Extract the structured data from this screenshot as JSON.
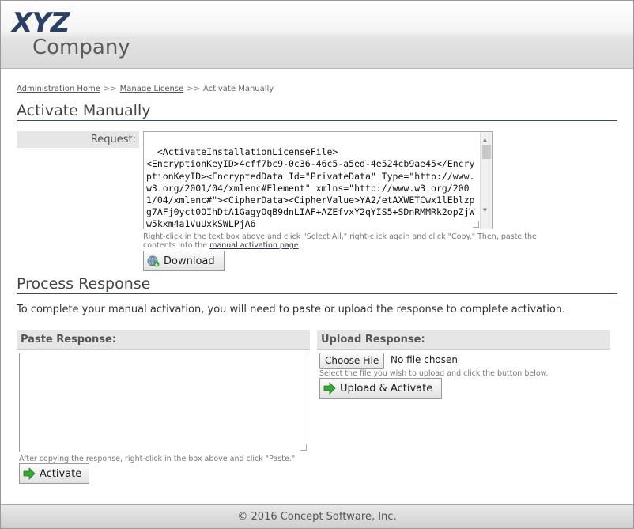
{
  "logo": {
    "line1": "XYZ",
    "line2": "Company"
  },
  "breadcrumb": {
    "items": [
      "Administration Home",
      "Manage License",
      "Activate Manually"
    ],
    "separator": ">>"
  },
  "activate_section": {
    "title": "Activate Manually",
    "request_label": "Request:",
    "request_text": "<ActivateInstallationLicenseFile>\n<EncryptionKeyID>4cff7bc9-0c36-46c5-a5ed-4e524cb9ae45</EncryptionKeyID><EncryptedData Id=\"PrivateData\" Type=\"http://www.w3.org/2001/04/xmlenc#Element\" xmlns=\"http://www.w3.org/2001/04/xmlenc#\"><CipherData><CipherValue>YA2/etAXWETCwx1lEblzpg7AFj0yct0OIhDtA1GagyOqB9dnLIAF+AZEfvxY2qYIS5+SDnRMMRk2opZjWw5kxm4a1VuUxkSWLPjA6",
    "hint_text": "Right-click in the text box above and click \"Select All,\" right-click again and click \"Copy.\" Then, paste the contents into the",
    "hint_link": "manual activation page",
    "hint_end": ".",
    "download_label": "Download"
  },
  "process_section": {
    "title": "Process Response",
    "description": "To complete your manual activation, you will need to paste or upload the response to complete activation.",
    "paste_header": "Paste Response:",
    "paste_value": "",
    "paste_hint": "After copying the response, right-click in the box above and click \"Paste.\"",
    "activate_label": "Activate",
    "upload_header": "Upload Response:",
    "choose_file_label": "Choose File",
    "file_status": "No file chosen",
    "upload_hint": "Select the file you wish to upload and click the button below.",
    "upload_activate_label": "Upload & Activate"
  },
  "footer": {
    "text": "© 2016 Concept Software, Inc."
  },
  "colors": {
    "accent": "#2b3f63",
    "button_icon_green": "#3aa63a"
  }
}
